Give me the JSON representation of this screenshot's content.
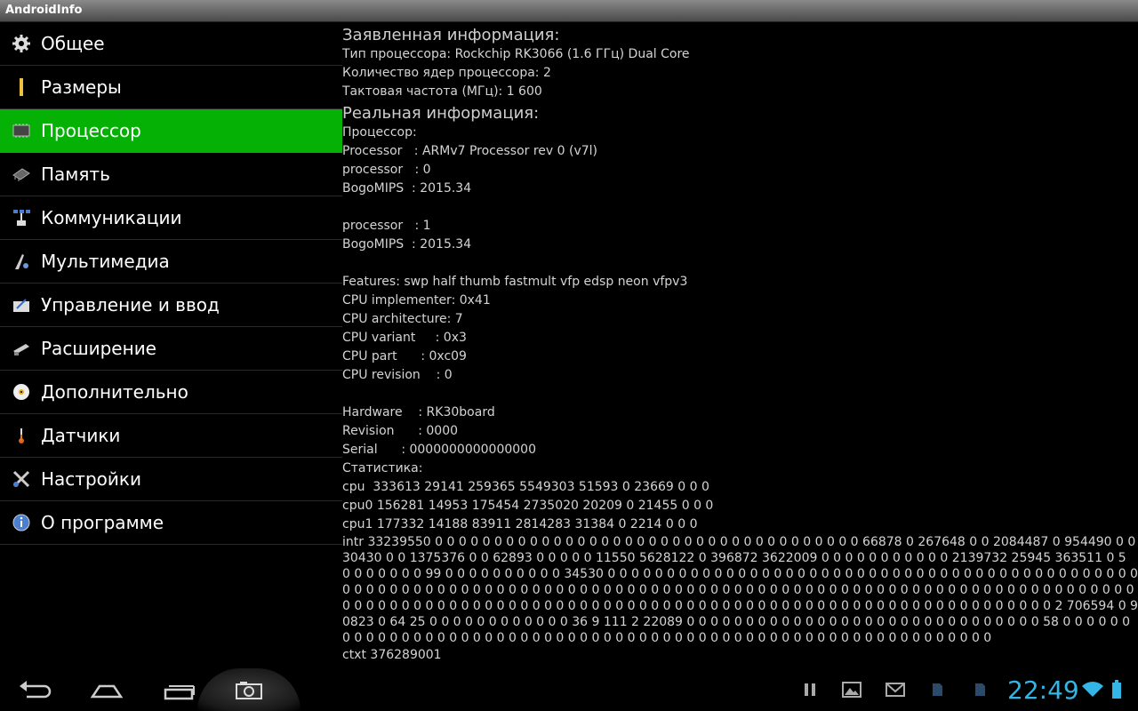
{
  "app": {
    "title": "AndroidInfo"
  },
  "sidebar": {
    "items": [
      {
        "label": "Общее",
        "icon": "gear-icon"
      },
      {
        "label": "Размеры",
        "icon": "ruler-icon"
      },
      {
        "label": "Процессор",
        "icon": "chip-icon",
        "selected": true
      },
      {
        "label": "Память",
        "icon": "memory-icon"
      },
      {
        "label": "Коммуникации",
        "icon": "network-icon"
      },
      {
        "label": "Мультимедиа",
        "icon": "multimedia-icon"
      },
      {
        "label": "Управление и ввод",
        "icon": "input-icon"
      },
      {
        "label": "Расширение",
        "icon": "expansion-icon"
      },
      {
        "label": "Дополнительно",
        "icon": "disc-icon"
      },
      {
        "label": "Датчики",
        "icon": "thermometer-icon"
      },
      {
        "label": "Настройки",
        "icon": "tools-icon"
      },
      {
        "label": "О программе",
        "icon": "info-icon"
      }
    ]
  },
  "content": {
    "declared": {
      "heading": "Заявленная информация:",
      "lines": [
        "Тип процессора: Rockchip RK3066 (1.6 ГГц) Dual Core",
        "Количество ядер процессора: 2",
        "Тактовая частота (МГц): 1 600"
      ]
    },
    "real": {
      "heading": "Реальная информация:",
      "lines": [
        "Процессор:",
        "Processor   : ARMv7 Processor rev 0 (v7l)",
        "processor   : 0",
        "BogoMIPS  : 2015.34",
        "",
        "processor   : 1",
        "BogoMIPS  : 2015.34",
        "",
        "Features: swp half thumb fastmult vfp edsp neon vfpv3",
        "CPU implementer: 0x41",
        "CPU architecture: 7",
        "CPU variant     : 0x3",
        "CPU part      : 0xc09",
        "CPU revision    : 0",
        "",
        "Hardware    : RK30board",
        "Revision      : 0000",
        "Serial      : 0000000000000000",
        "Статистика:",
        "cpu  333613 29141 259365 5549303 51593 0 23669 0 0 0",
        "cpu0 156281 14953 175454 2735020 20209 0 21455 0 0 0",
        "cpu1 177332 14188 83911 2814283 31384 0 2214 0 0 0"
      ],
      "intr": "intr 33239550 0 0 0 0 0 0 0 0 0 0 0 0 0 0 0 0 0 0 0 0 0 0 0 0 0 0 0 0 0 0 0 0 0 0 0 0 66878 0 267648 0 0 2084487 0 954490 0 0 30430 0 0 1375376 0 0 62893 0 0 0 0 0 11550 5628122 0 396872 3622009 0 0 0 0 0 0 0 0 0 0 0 2139732 25945 363511 0 5 0 0 0 0 0 0 0 99 0 0 0 0 0 0 0 0 0 0 34530 0 0 0 0 0 0 0 0 0 0 0 0 0 0 0 0 0 0 0 0 0 0 0 0 0 0 0 0 0 0 0 0 0 0 0 0 0 0 0 0 0 0 0 0 0 0 0 0 0 0 0 0 0 0 0 0 0 0 0 0 0 0 0 0 0 0 0 0 0 0 0 0 0 0 0 0 0 0 0 0 0 0 0 0 0 0 0 0 0 0 0 0 0 0 0 0 0 0 0 0 0 0 0 0 0 0 0 0 0 0 0 0 0 0 0 0 0 0 0 0 0 0 0 0 0 0 0 0 0 0 0 0 0 0 0 0 0 0 0 0 0 0 0 0 0 0 0 0 0 0 0 0 0 0 0 0 0 0 0 0 0 0 0 0 0 0 0 0 0 0 0 0 2 706594 0 90823 0 64 25 0 0 0 0 0 0 0 0 0 0 0 0 36 9 111 2 22089 0 0 0 0 0 0 0 0 0 0 0 0 0 0 0 0 0 0 0 0 0 0 0 0 0 0 0 0 0 0 58 0 0 0 0 0 0 0 0 0 0 0 0 0 0 0 0 0 0 0 0 0 0 0 0 0 0 0 0 0 0 0 0 0 0 0 0 0 0 0 0 0 0 0 0 0 0 0 0 0 0 0 0 0 0 0 0 0 0 0 0 0",
      "ctxt": "ctxt 376289001"
    }
  },
  "statusbar": {
    "time": "22:49"
  },
  "colors": {
    "selected": "#06b106",
    "accent": "#33b5e5"
  }
}
